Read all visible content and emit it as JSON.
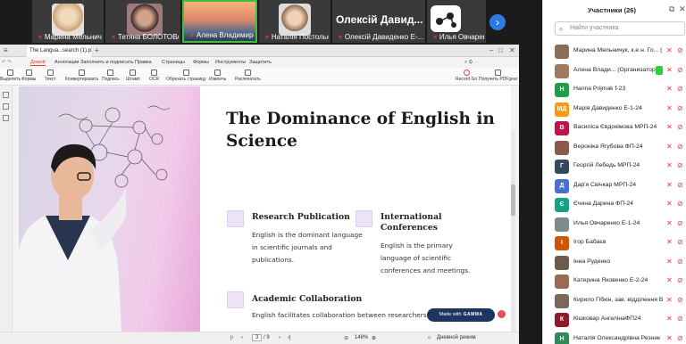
{
  "meeting": {
    "tiles": [
      {
        "name": "Марина Мельничук, к..."
      },
      {
        "name": "Тетяна БОЛОТОВА, За..."
      },
      {
        "name": "Алена Владимировна Са..."
      },
      {
        "name": "Наталія Постольна"
      },
      {
        "name": "Олексій Давиденко Е-..."
      },
      {
        "name": "Илья Овчаренко Е-1-..."
      }
    ],
    "featured_name": "Олексій Давид..."
  },
  "pdf": {
    "tab_title": "The Langua...search (1).pdf",
    "menu": [
      "Домой",
      "Аннотации",
      "Заполнить и подписать",
      "Правка",
      "Страницы",
      "Формы",
      "Инструменты",
      "Защитить"
    ],
    "toolbar": [
      "Выделить",
      "Формы",
      "Текст",
      "Конвертировать",
      "Подпись",
      "Штамп",
      "OCR",
      "Обрезать страницу",
      "Извлечь",
      "Распечатать"
    ],
    "toolbar_right": [
      "Record Go",
      "Получить PDFgear"
    ],
    "page_current": "3",
    "page_total": "/ 9",
    "zoom": "148%",
    "view_mode": "Дневной режим"
  },
  "slide": {
    "title": "The Dominance of English in Science",
    "cards": [
      {
        "title": "Research Publication",
        "desc": "English is the dominant language in scientific journals and publications."
      },
      {
        "title": "International Conferences",
        "desc": "English is the primary language of scientific conferences and meetings."
      },
      {
        "title": "Academic Collaboration",
        "desc": "English facilitates collaboration between researchers worldwide."
      }
    ],
    "made_with": "Made with",
    "brand": "GAMMA"
  },
  "participants": {
    "title": "Участники (26)",
    "search_placeholder": "Найти участника",
    "list": [
      {
        "name": "Марина Мельничук, к.е.н. Го... (Я)",
        "initials": "",
        "color": "#8a6d5a"
      },
      {
        "name": "Алена Влади... (Организатор)",
        "initials": "",
        "color": "#a07a60"
      },
      {
        "name": "Hanna Prijmak f-23",
        "initials": "H",
        "color": "#1e9e4a"
      },
      {
        "name": "Марія Давиденко Е-1-24",
        "initials": "МД",
        "color": "#f39c12"
      },
      {
        "name": "Василіса Євдокімова МРП-24",
        "initials": "В",
        "color": "#c0154b"
      },
      {
        "name": "Вероніка Ягубова ФП-24",
        "initials": "",
        "color": "#8a5a4a"
      },
      {
        "name": "Георгій Лебедь МРП-24",
        "initials": "Г",
        "color": "#34495e"
      },
      {
        "name": "Дар'я Свічкар МРП-24",
        "initials": "Д",
        "color": "#4a6fd4"
      },
      {
        "name": "Єчина Дарина ФП-24",
        "initials": "Є",
        "color": "#16a085"
      },
      {
        "name": "Илья Овчаренко Е-1-24",
        "initials": "",
        "color": "#7f8c8d"
      },
      {
        "name": "Ігор Бабаєв",
        "initials": "І",
        "color": "#d35400"
      },
      {
        "name": "Інна Руденко",
        "initials": "",
        "color": "#6c5a4a"
      },
      {
        "name": "Катерина Яковенко Е-2-24",
        "initials": "",
        "color": "#9b6a55"
      },
      {
        "name": "Кирило Гібкін, зав. відділення В...",
        "initials": "",
        "color": "#7a6858"
      },
      {
        "name": "Кішковар АнгелінаФП24",
        "initials": "К",
        "color": "#8e1b2b"
      },
      {
        "name": "Наталія Олександрівна Резник",
        "initials": "Н",
        "color": "#2e8b57"
      }
    ]
  }
}
